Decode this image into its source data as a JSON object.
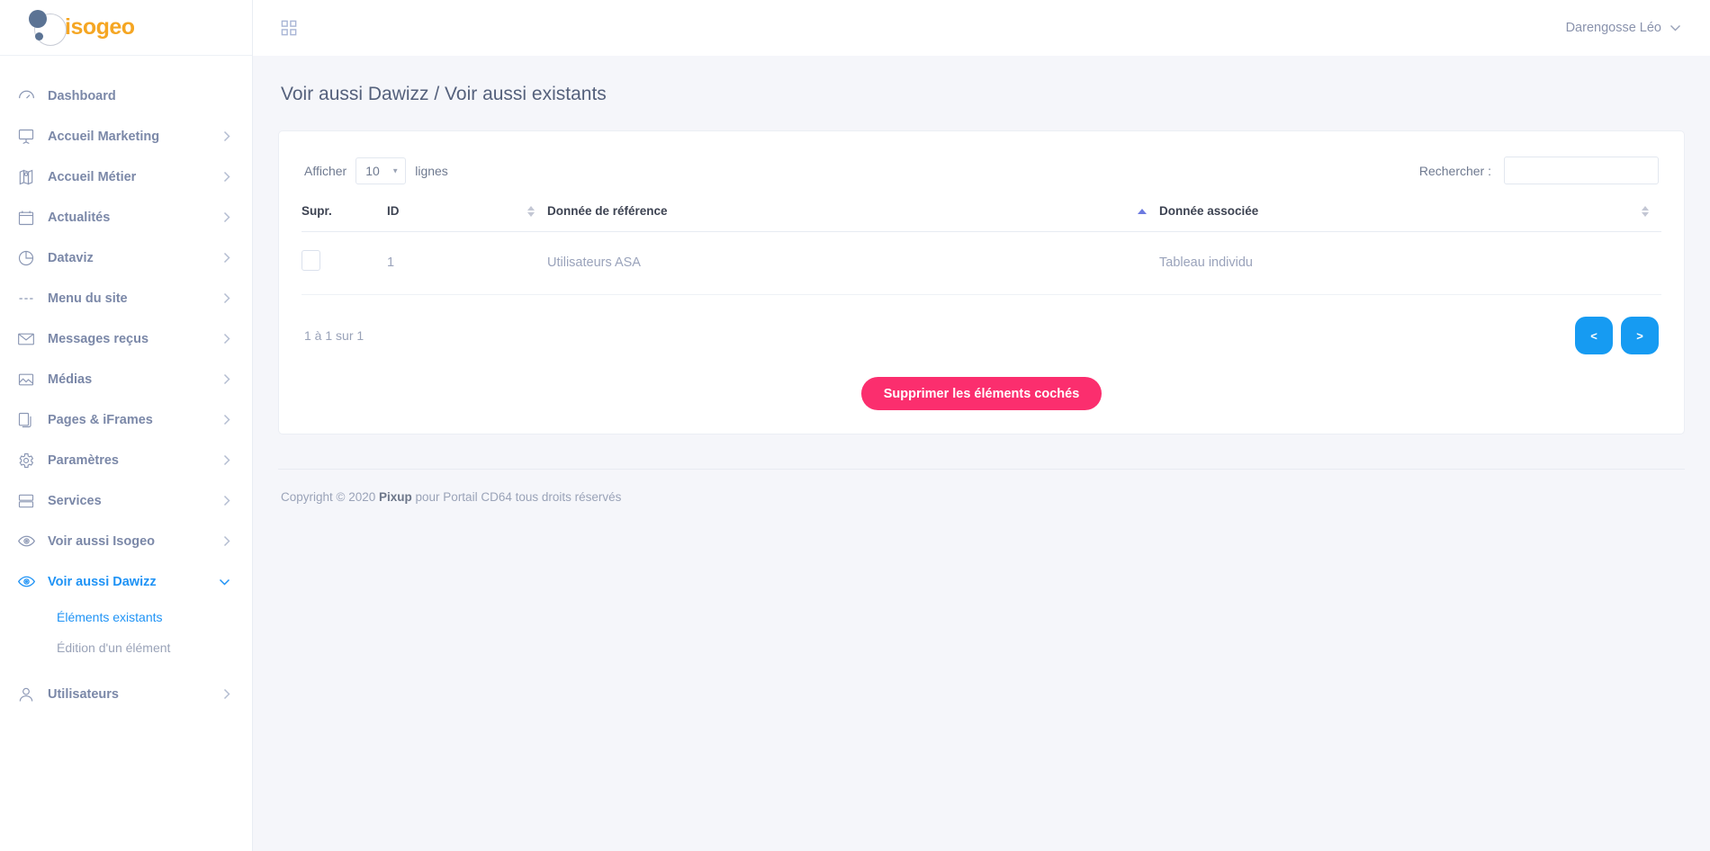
{
  "brand": {
    "name": "isogeo",
    "icon": "isogeo-logo"
  },
  "topbar": {
    "grid_icon": "grid-apps-icon",
    "user_name": "Darengosse Léo",
    "user_chevron": "chevron-down-icon"
  },
  "page": {
    "title": "Voir aussi Dawizz / Voir aussi existants"
  },
  "sidebar": {
    "items": [
      {
        "label": "Dashboard",
        "icon": "dashboard-gauge-icon",
        "chevron": false,
        "active": false
      },
      {
        "label": "Accueil Marketing",
        "icon": "presentation-board-icon",
        "chevron": true,
        "active": false
      },
      {
        "label": "Accueil Métier",
        "icon": "map-pin-icon",
        "chevron": true,
        "active": false
      },
      {
        "label": "Actualités",
        "icon": "calendar-icon",
        "chevron": true,
        "active": false
      },
      {
        "label": "Dataviz",
        "icon": "pie-chart-icon",
        "chevron": true,
        "active": false
      },
      {
        "label": "Menu du site",
        "icon": "menu-dashes-icon",
        "chevron": true,
        "active": false
      },
      {
        "label": "Messages reçus",
        "icon": "envelope-icon",
        "chevron": true,
        "active": false
      },
      {
        "label": "Médias",
        "icon": "image-icon",
        "chevron": true,
        "active": false
      },
      {
        "label": "Pages & iFrames",
        "icon": "pages-copy-icon",
        "chevron": true,
        "active": false
      },
      {
        "label": "Paramètres",
        "icon": "gear-icon",
        "chevron": true,
        "active": false
      },
      {
        "label": "Services",
        "icon": "server-icon",
        "chevron": true,
        "active": false
      },
      {
        "label": "Voir aussi Isogeo",
        "icon": "eye-icon",
        "chevron": true,
        "active": false
      },
      {
        "label": "Voir aussi Dawizz",
        "icon": "eye-icon",
        "chevron": true,
        "active": true
      }
    ],
    "sub_items": [
      {
        "label": "Éléments existants",
        "active": true
      },
      {
        "label": "Édition d'un élément",
        "active": false
      }
    ],
    "bottom_item": {
      "label": "Utilisateurs",
      "icon": "user-icon",
      "chevron": true
    }
  },
  "table_controls": {
    "afficher_label": "Afficher",
    "page_length": "10",
    "lignes_label": "lignes",
    "search_label": "Rechercher :",
    "search_value": "",
    "search_placeholder": ""
  },
  "table": {
    "columns": [
      {
        "label": "Supr.",
        "sortable": false,
        "sort": "none"
      },
      {
        "label": "ID",
        "sortable": true,
        "sort": "none"
      },
      {
        "label": "Donnée de référence",
        "sortable": true,
        "sort": "asc"
      },
      {
        "label": "Donnée associée",
        "sortable": true,
        "sort": "none"
      }
    ],
    "rows": [
      {
        "checked": false,
        "id": "1",
        "reference": "Utilisateurs ASA",
        "associated": "Tableau individu"
      }
    ]
  },
  "pagination": {
    "info": "1 à 1 sur 1",
    "prev_label": "<",
    "next_label": ">"
  },
  "actions": {
    "delete_label": "Supprimer les éléments cochés"
  },
  "footer": {
    "prefix": "Copyright © 2020 ",
    "brand": "Pixup",
    "suffix": " pour Portail CD64 tous droits réservés"
  },
  "colors": {
    "accent_blue": "#169bf2",
    "brand_orange": "#f5a623",
    "danger_pink": "#fb2e6e",
    "sort_active": "#6c7ae0",
    "page_bg": "#f5f6fa",
    "text_muted": "#9aa3b8"
  }
}
